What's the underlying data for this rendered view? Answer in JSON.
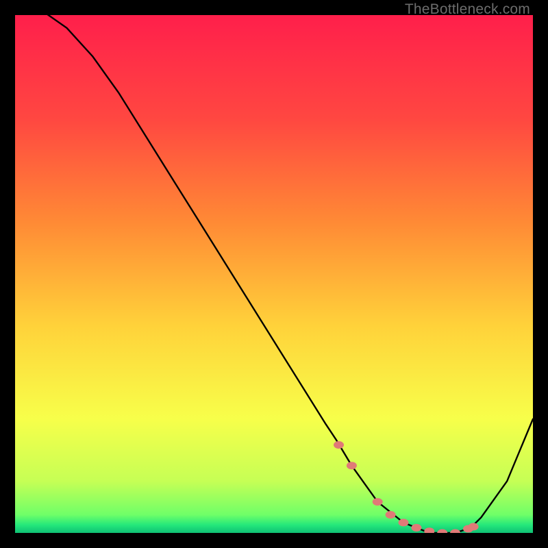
{
  "watermark": "TheBottleneck.com",
  "chart_data": {
    "type": "line",
    "title": "",
    "xlabel": "",
    "ylabel": "",
    "xlim": [
      0,
      100
    ],
    "ylim": [
      0,
      100
    ],
    "grid": false,
    "legend": false,
    "series": [
      {
        "name": "curve",
        "x": [
          0,
          5,
          10,
          15,
          20,
          25,
          30,
          35,
          40,
          45,
          50,
          55,
          60,
          62,
          65,
          70,
          75,
          80,
          85,
          88,
          90,
          95,
          100
        ],
        "y": [
          104,
          101,
          97.5,
          92,
          85,
          77,
          69,
          61,
          53,
          45,
          37,
          29,
          21,
          18,
          13,
          6,
          2,
          0,
          0,
          1,
          3,
          10,
          22
        ]
      }
    ],
    "markers": {
      "name": "highlight-dots",
      "color": "#e07a77",
      "x": [
        62.5,
        65.0,
        70.0,
        72.5,
        75.0,
        77.5,
        80.0,
        82.5,
        85.0,
        87.5,
        88.5
      ],
      "y": [
        17.0,
        13.0,
        6.0,
        3.5,
        2.0,
        1.0,
        0.3,
        0.0,
        0.0,
        0.8,
        1.2
      ]
    },
    "background_gradient": {
      "stops": [
        {
          "offset": 0.0,
          "color": "#ff1f4b"
        },
        {
          "offset": 0.2,
          "color": "#ff4741"
        },
        {
          "offset": 0.4,
          "color": "#ff8a35"
        },
        {
          "offset": 0.6,
          "color": "#ffd23a"
        },
        {
          "offset": 0.78,
          "color": "#f7ff4a"
        },
        {
          "offset": 0.9,
          "color": "#c6ff55"
        },
        {
          "offset": 0.965,
          "color": "#6fff68"
        },
        {
          "offset": 0.985,
          "color": "#23e77b"
        },
        {
          "offset": 1.0,
          "color": "#0fc074"
        }
      ]
    }
  }
}
